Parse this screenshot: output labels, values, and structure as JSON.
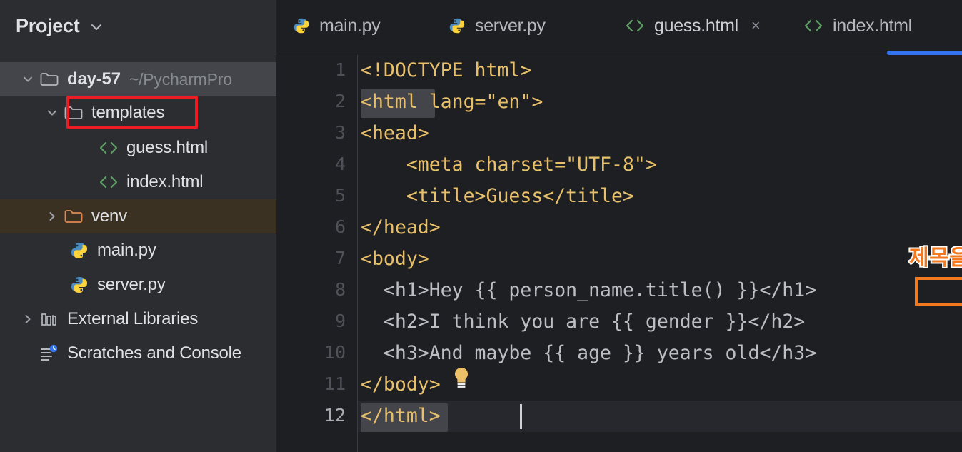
{
  "window": {
    "theme_bg": "#1e1f22",
    "sidebar_bg": "#2b2d30",
    "accent_blue": "#3574F0",
    "annotation_red": "#EC1C24",
    "annotation_orange": "#F4781D"
  },
  "sidebar": {
    "title": "Project",
    "toggle_icon": "chevron-down-icon",
    "tree": [
      {
        "label": "day-57",
        "path": "~/PycharmPro",
        "icon": "folder-icon",
        "twisty": "chevron-down-icon",
        "depth": 0,
        "selected": true,
        "bold": true
      },
      {
        "label": "templates",
        "path": "",
        "icon": "folder-icon",
        "twisty": "chevron-down-icon",
        "depth": 1,
        "selected": false,
        "bold": false,
        "annotated": true
      },
      {
        "label": "guess.html",
        "path": "",
        "icon": "html-file-icon",
        "twisty": "",
        "depth": 2,
        "selected": false,
        "bold": false
      },
      {
        "label": "index.html",
        "path": "",
        "icon": "html-file-icon",
        "twisty": "",
        "depth": 2,
        "selected": false,
        "bold": false
      },
      {
        "label": "venv",
        "path": "",
        "icon": "folder-excluded-icon",
        "twisty": "chevron-right-icon",
        "depth": 1,
        "selected": false,
        "bold": false,
        "highlighted": true
      },
      {
        "label": "main.py",
        "path": "",
        "icon": "python-file-icon",
        "twisty": "",
        "depth": 1,
        "selected": false,
        "bold": false
      },
      {
        "label": "server.py",
        "path": "",
        "icon": "python-file-icon",
        "twisty": "",
        "depth": 1,
        "selected": false,
        "bold": false
      },
      {
        "label": "External Libraries",
        "path": "",
        "icon": "libraries-icon",
        "twisty": "chevron-right-icon",
        "depth": 0,
        "selected": false,
        "bold": false
      },
      {
        "label": "Scratches and Console",
        "path": "",
        "icon": "scratches-icon",
        "twisty": "",
        "depth": 0,
        "selected": false,
        "bold": false
      }
    ]
  },
  "tabs": [
    {
      "label": "main.py",
      "icon": "python-file-icon",
      "active": false,
      "closable": false
    },
    {
      "label": "server.py",
      "icon": "python-file-icon",
      "active": false,
      "closable": false
    },
    {
      "label": "guess.html",
      "icon": "html-file-icon",
      "active": true,
      "closable": true,
      "close_glyph": "×"
    },
    {
      "label": "index.html",
      "icon": "html-file-icon",
      "active": false,
      "closable": false
    }
  ],
  "editor": {
    "file": "guess.html",
    "language": "html",
    "cursor_line": 12,
    "line_numbers": [
      "1",
      "2",
      "3",
      "4",
      "5",
      "6",
      "7",
      "8",
      "9",
      "10",
      "11",
      "12"
    ],
    "lines": [
      {
        "n": "1",
        "text": "<!DOCTYPE html>"
      },
      {
        "n": "2",
        "text": "<html lang=\"en\">"
      },
      {
        "n": "3",
        "text": "<head>"
      },
      {
        "n": "4",
        "text": "    <meta charset=\"UTF-8\">"
      },
      {
        "n": "5",
        "text": "    <title>Guess</title>"
      },
      {
        "n": "6",
        "text": "</head>"
      },
      {
        "n": "7",
        "text": "<body>"
      },
      {
        "n": "8",
        "text": "  <h1>Hey {{ person_name.title() }}</h1>"
      },
      {
        "n": "9",
        "text": "  <h2>I think you are {{ gender }}</h2>"
      },
      {
        "n": "10",
        "text": "  <h3>And maybe {{ age }} years old</h3>"
      },
      {
        "n": "11",
        "text": "</body>"
      },
      {
        "n": "12",
        "text": "</html>"
      }
    ],
    "intention_bulb": "lightbulb-icon"
  },
  "annotations": {
    "korean_note": "제목을 대문자로 변경",
    "red_box_target": "templates",
    "orange_box_target": "title()"
  }
}
